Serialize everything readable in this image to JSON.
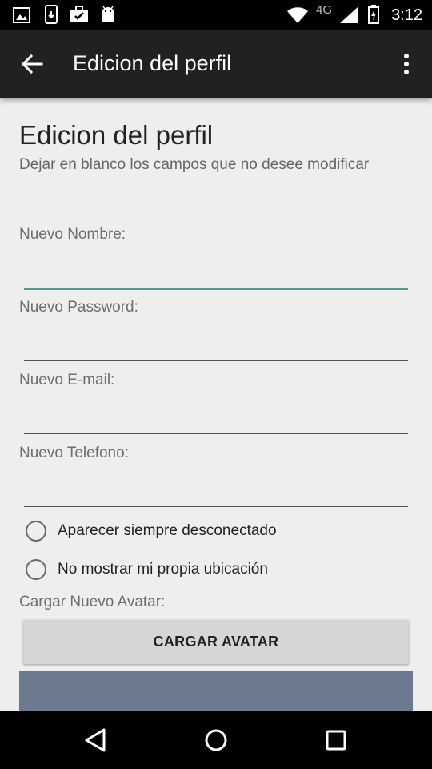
{
  "status_bar": {
    "time": "3:12",
    "network": "4G",
    "left_icons": [
      "image-icon",
      "phone-download-icon",
      "briefcase-check-icon",
      "android-icon"
    ],
    "right_icons": [
      "wifi-icon",
      "signal-icon",
      "battery-icon"
    ]
  },
  "app_bar": {
    "title": "Edicion del perfil",
    "back_icon": "arrow-back-icon",
    "menu_icon": "more-vert-icon"
  },
  "form": {
    "title": "Edicion del perfil",
    "subtitle": "Dejar en blanco los campos que no desee modificar",
    "fields": [
      {
        "label": "Nuevo Nombre:",
        "value": ""
      },
      {
        "label": "Nuevo Password:",
        "value": ""
      },
      {
        "label": "Nuevo E-mail:",
        "value": ""
      },
      {
        "label": "Nuevo Telefono:",
        "value": ""
      }
    ],
    "options": [
      {
        "label": "Aparecer siempre desconectado",
        "checked": false
      },
      {
        "label": "No mostrar mi propia ubicación",
        "checked": false
      }
    ],
    "avatar_label": "Cargar Nuevo Avatar:",
    "avatar_button": "CARGAR AVATAR"
  },
  "colors": {
    "app_bar": "#212121",
    "accent": "#4a9b94",
    "avatar_preview": "#6b7a8f",
    "background": "#eeeeee"
  },
  "nav_bar": {
    "icons": [
      "back-triangle-icon",
      "home-circle-icon",
      "recents-square-icon"
    ]
  }
}
